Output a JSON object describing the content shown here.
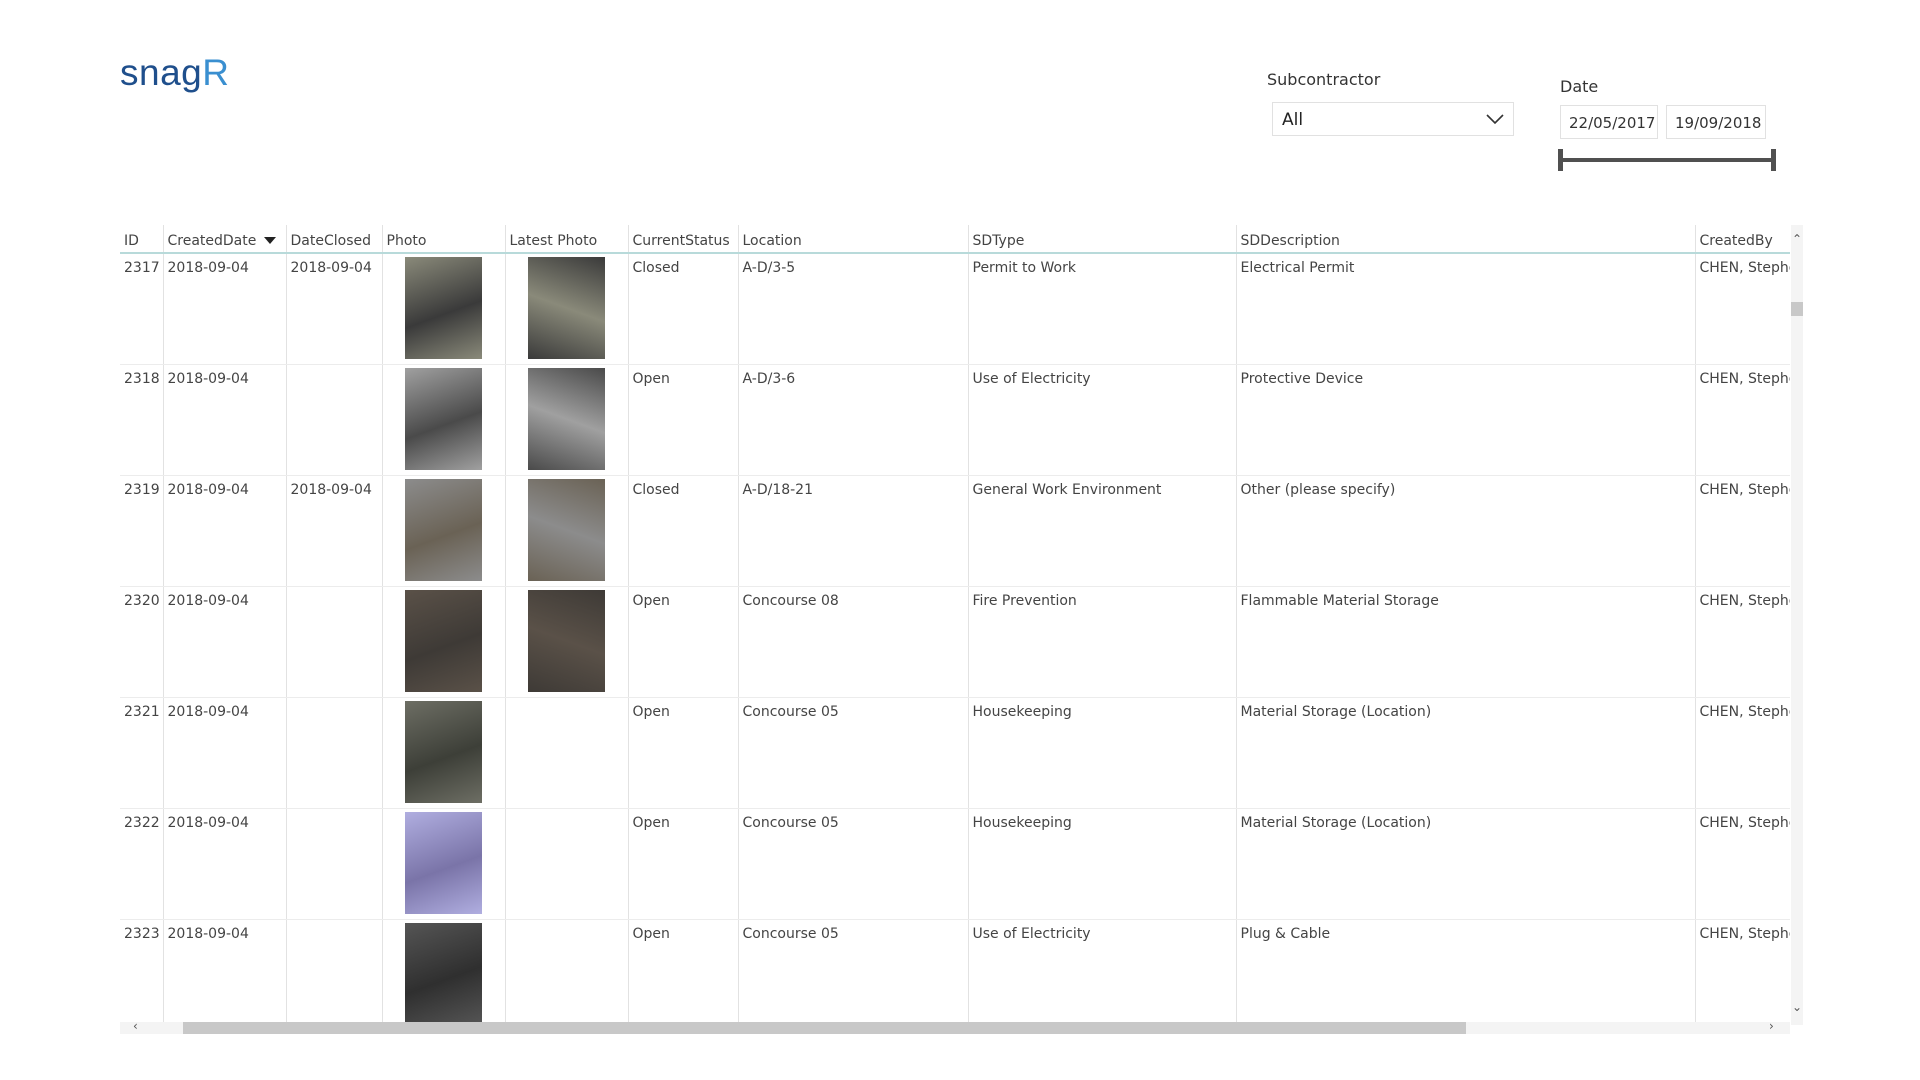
{
  "app": {
    "logo_text": "snag",
    "logo_accent": "R"
  },
  "filters": {
    "subcontractor_label": "Subcontractor",
    "subcontractor_value": "All",
    "date_label": "Date",
    "date_from": "22/05/2017",
    "date_to": "19/09/2018"
  },
  "table": {
    "columns": [
      "ID",
      "CreatedDate",
      "DateClosed",
      "Photo",
      "Latest Photo",
      "CurrentStatus",
      "Location",
      "SDType",
      "SDDescription",
      "CreatedBy"
    ],
    "sorted_column": "CreatedDate",
    "rows": [
      {
        "id": "2317",
        "created": "2018-09-04",
        "closed": "2018-09-04",
        "status": "Closed",
        "location": "A-D/3-5",
        "sdtype": "Permit to Work",
        "sddesc": "Electrical Permit",
        "createdby": "CHEN, Stephe",
        "photo": "photo",
        "latest": "photo"
      },
      {
        "id": "2318",
        "created": "2018-09-04",
        "closed": "",
        "status": "Open",
        "location": "A-D/3-6",
        "sdtype": "Use of Electricity",
        "sddesc": "Protective Device",
        "createdby": "CHEN, Stephe",
        "photo": "photo",
        "latest": "photo"
      },
      {
        "id": "2319",
        "created": "2018-09-04",
        "closed": "2018-09-04",
        "status": "Closed",
        "location": "A-D/18-21",
        "sdtype": "General Work Environment",
        "sddesc": "Other (please specify)",
        "createdby": "CHEN, Stephe",
        "photo": "photo",
        "latest": "photo"
      },
      {
        "id": "2320",
        "created": "2018-09-04",
        "closed": "",
        "status": "Open",
        "location": "Concourse 08",
        "sdtype": "Fire Prevention",
        "sddesc": "Flammable Material Storage",
        "createdby": "CHEN, Stephe",
        "photo": "photo",
        "latest": "photo"
      },
      {
        "id": "2321",
        "created": "2018-09-04",
        "closed": "",
        "status": "Open",
        "location": "Concourse 05",
        "sdtype": "Housekeeping",
        "sddesc": "Material Storage (Location)",
        "createdby": "CHEN, Stephe",
        "photo": "photo",
        "latest": ""
      },
      {
        "id": "2322",
        "created": "2018-09-04",
        "closed": "",
        "status": "Open",
        "location": "Concourse 05",
        "sdtype": "Housekeeping",
        "sddesc": "Material Storage (Location)",
        "createdby": "CHEN, Stephe",
        "photo": "photo",
        "latest": ""
      },
      {
        "id": "2323",
        "created": "2018-09-04",
        "closed": "",
        "status": "Open",
        "location": "Concourse 05",
        "sdtype": "Use of Electricity",
        "sddesc": "Plug & Cable",
        "createdby": "CHEN, Stephe",
        "photo": "photo",
        "latest": ""
      }
    ]
  },
  "colors": {
    "logo": "#1f4f8c",
    "logo_accent": "#3a8fd0",
    "header_rule": "#b8dada"
  }
}
